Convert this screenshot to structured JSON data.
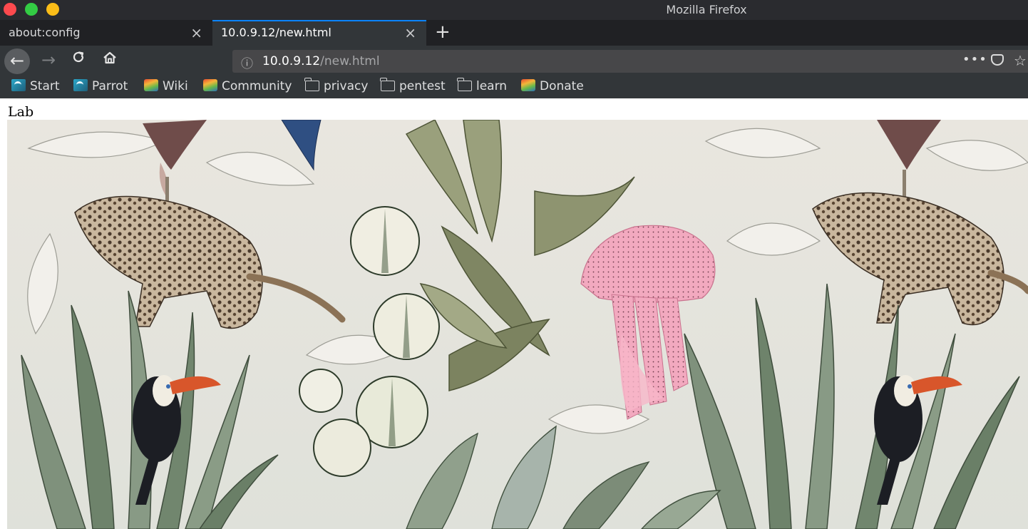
{
  "window": {
    "title": "Mozilla Firefox"
  },
  "tabs": [
    {
      "label": "about:config",
      "close": "×",
      "active": false
    },
    {
      "label": "10.0.9.12/new.html",
      "close": "×",
      "active": true
    }
  ],
  "new_tab_label": "+",
  "navigation": {
    "back_icon": "←",
    "forward_icon": "→",
    "reload_icon": "C",
    "home_icon": "⌂"
  },
  "url": {
    "info_icon": "ⓘ",
    "host": "10.0.9.12",
    "path": "/new.html",
    "more_icon": "•••",
    "star_icon": "☆"
  },
  "bookmarks": [
    {
      "label": "Start",
      "icon": "parrot-icon"
    },
    {
      "label": "Parrot",
      "icon": "parrot-icon"
    },
    {
      "label": "Wiki",
      "icon": "wiki-icon"
    },
    {
      "label": "Community",
      "icon": "wiki-icon"
    },
    {
      "label": "privacy",
      "icon": "folder-icon"
    },
    {
      "label": "pentest",
      "icon": "folder-icon"
    },
    {
      "label": "learn",
      "icon": "folder-icon"
    },
    {
      "label": "Donate",
      "icon": "wiki-icon"
    }
  ],
  "page": {
    "heading": "Lab",
    "image_description": "botanical-jungle-wallpaper"
  },
  "colors": {
    "titlebar": "#2a2b2f",
    "tabstrip": "#202124",
    "toolbar": "#323639",
    "urlbar": "#474749",
    "tab_accent": "#0a84ff",
    "close_dot": "#fd4a4e",
    "min_dot": "#33cc44",
    "max_dot": "#fbbd18"
  }
}
